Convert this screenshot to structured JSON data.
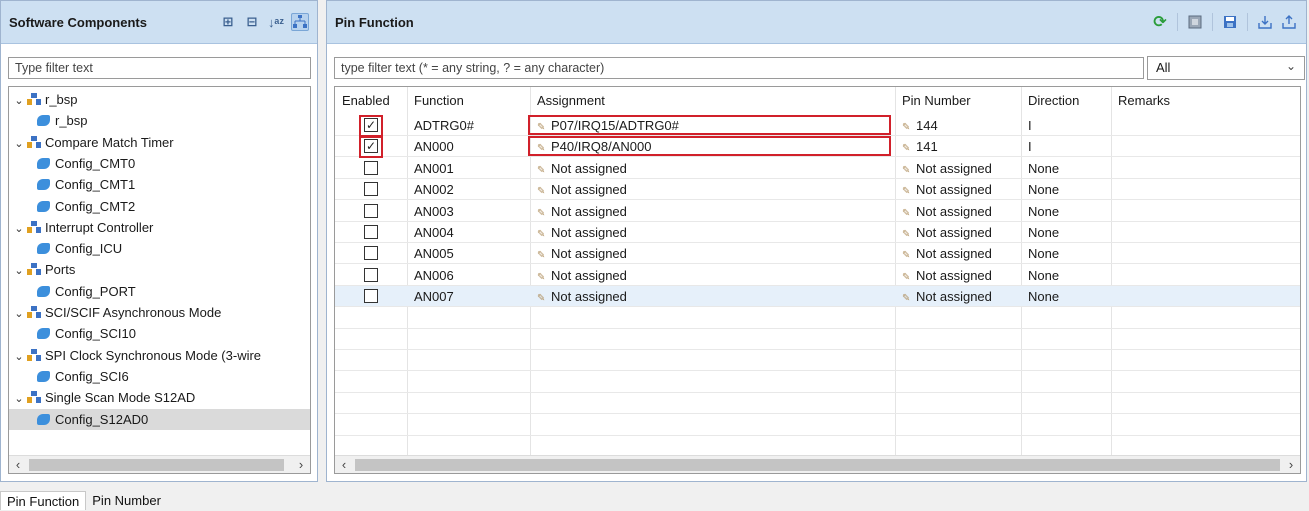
{
  "left_panel": {
    "title": "Software Components",
    "filter_placeholder": "Type filter text",
    "toolbar_icons": [
      "expand-all-icon",
      "collapse-all-icon",
      "sort-az-icon",
      "hierarchy-view-icon"
    ],
    "tree": [
      {
        "label": "r_bsp",
        "level": 0,
        "kind": "component",
        "expanded": true
      },
      {
        "label": "r_bsp",
        "level": 1,
        "kind": "config"
      },
      {
        "label": "Compare Match Timer",
        "level": 0,
        "kind": "component",
        "expanded": true
      },
      {
        "label": "Config_CMT0",
        "level": 1,
        "kind": "config"
      },
      {
        "label": "Config_CMT1",
        "level": 1,
        "kind": "config"
      },
      {
        "label": "Config_CMT2",
        "level": 1,
        "kind": "config"
      },
      {
        "label": "Interrupt Controller",
        "level": 0,
        "kind": "component",
        "expanded": true
      },
      {
        "label": "Config_ICU",
        "level": 1,
        "kind": "config"
      },
      {
        "label": "Ports",
        "level": 0,
        "kind": "component",
        "expanded": true
      },
      {
        "label": "Config_PORT",
        "level": 1,
        "kind": "config"
      },
      {
        "label": "SCI/SCIF Asynchronous Mode",
        "level": 0,
        "kind": "component",
        "expanded": true
      },
      {
        "label": "Config_SCI10",
        "level": 1,
        "kind": "config"
      },
      {
        "label": "SPI Clock Synchronous Mode (3-wire",
        "level": 0,
        "kind": "component",
        "expanded": true
      },
      {
        "label": "Config_SCI6",
        "level": 1,
        "kind": "config"
      },
      {
        "label": "Single Scan Mode S12AD",
        "level": 0,
        "kind": "component",
        "expanded": true
      },
      {
        "label": "Config_S12AD0",
        "level": 1,
        "kind": "config",
        "selected": true
      }
    ]
  },
  "right_panel": {
    "title": "Pin Function",
    "toolbar_icons": [
      "refresh-icon",
      "board-icon",
      "save-icon",
      "import-icon",
      "export-icon"
    ],
    "filter_placeholder": "type filter text (* = any string, ? = any character)",
    "filter_select": {
      "value": "All"
    },
    "columns": [
      "Enabled",
      "Function",
      "Assignment",
      "Pin Number",
      "Direction",
      "Remarks"
    ],
    "rows": [
      {
        "enabled": true,
        "function": "ADTRG0#",
        "assignment": "P07/IRQ15/ADTRG0#",
        "pin_number": "144",
        "direction": "I",
        "remarks": "",
        "highlighted": false
      },
      {
        "enabled": true,
        "function": "AN000",
        "assignment": "P40/IRQ8/AN000",
        "pin_number": "141",
        "direction": "I",
        "remarks": "",
        "highlighted": false
      },
      {
        "enabled": false,
        "function": "AN001",
        "assignment": "Not assigned",
        "pin_number": "Not assigned",
        "direction": "None",
        "remarks": "",
        "highlighted": false
      },
      {
        "enabled": false,
        "function": "AN002",
        "assignment": "Not assigned",
        "pin_number": "Not assigned",
        "direction": "None",
        "remarks": "",
        "highlighted": false
      },
      {
        "enabled": false,
        "function": "AN003",
        "assignment": "Not assigned",
        "pin_number": "Not assigned",
        "direction": "None",
        "remarks": "",
        "highlighted": false
      },
      {
        "enabled": false,
        "function": "AN004",
        "assignment": "Not assigned",
        "pin_number": "Not assigned",
        "direction": "None",
        "remarks": "",
        "highlighted": false
      },
      {
        "enabled": false,
        "function": "AN005",
        "assignment": "Not assigned",
        "pin_number": "Not assigned",
        "direction": "None",
        "remarks": "",
        "highlighted": false
      },
      {
        "enabled": false,
        "function": "AN006",
        "assignment": "Not assigned",
        "pin_number": "Not assigned",
        "direction": "None",
        "remarks": "",
        "highlighted": false
      },
      {
        "enabled": false,
        "function": "AN007",
        "assignment": "Not assigned",
        "pin_number": "Not assigned",
        "direction": "None",
        "remarks": "",
        "highlighted": true
      }
    ],
    "annotation_color": "#d1202a"
  },
  "bottom_tabs": [
    {
      "label": "Pin Function",
      "active": true
    },
    {
      "label": "Pin Number",
      "active": false
    }
  ]
}
